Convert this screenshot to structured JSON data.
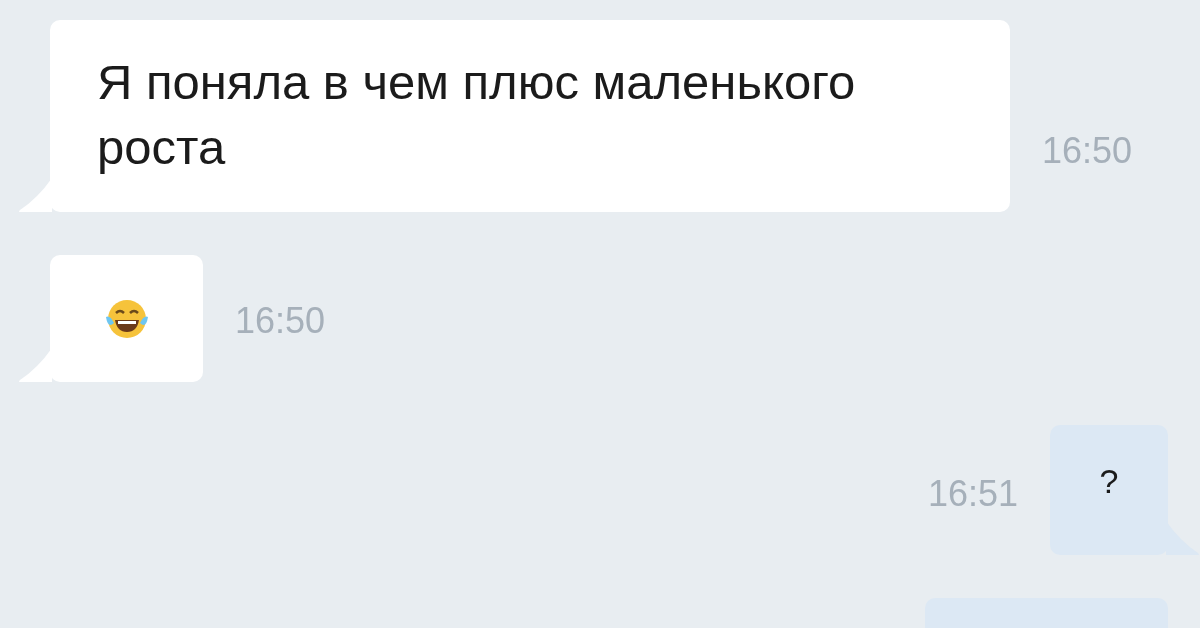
{
  "messages": [
    {
      "outgoing": false,
      "kind": "text",
      "text": "Я поняла в чем плюс маленького роста",
      "time": "16:50"
    },
    {
      "outgoing": false,
      "kind": "emoji",
      "time": "16:50"
    },
    {
      "outgoing": true,
      "kind": "text",
      "text": "?",
      "time": "16:51"
    },
    {
      "outgoing": true,
      "kind": "empty"
    }
  ]
}
